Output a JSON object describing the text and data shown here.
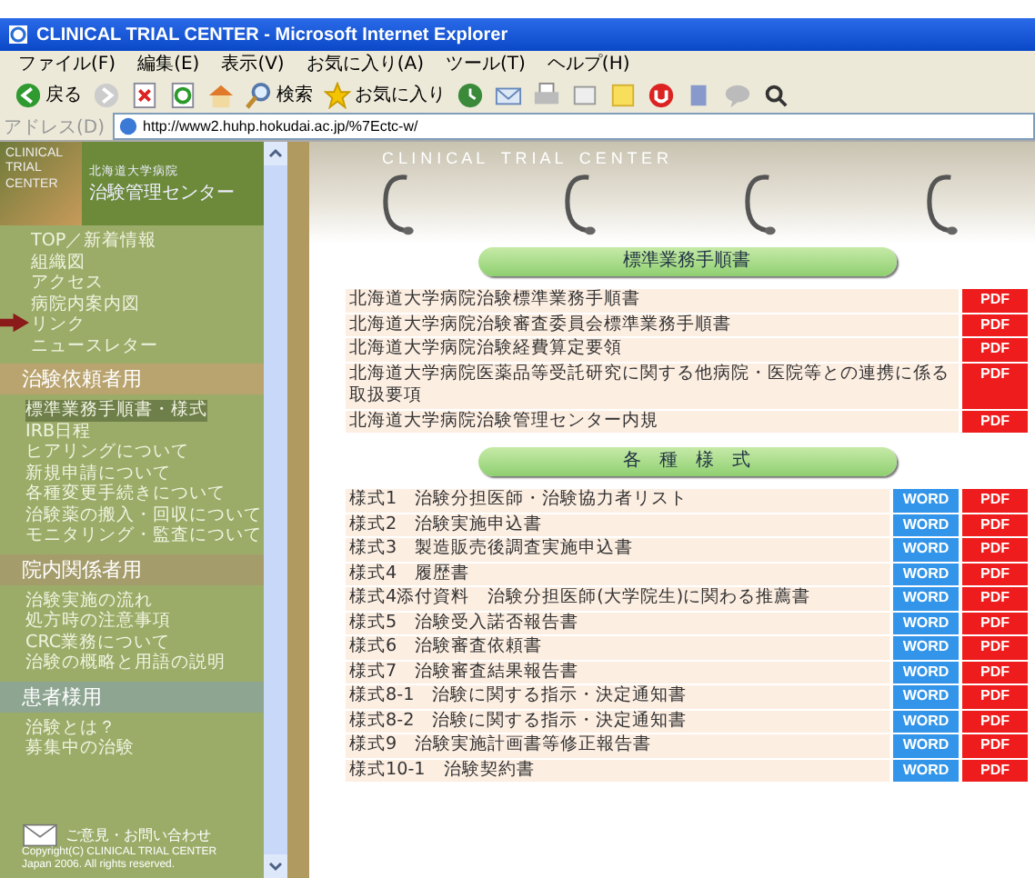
{
  "window": {
    "title": "CLINICAL TRIAL CENTER - Microsoft Internet Explorer"
  },
  "menu": [
    "ファイル(F)",
    "編集(E)",
    "表示(V)",
    "お気に入り(A)",
    "ツール(T)",
    "ヘルプ(H)"
  ],
  "toolbar": {
    "back": "戻る",
    "search": "検索",
    "favorites": "お気に入り"
  },
  "address": {
    "label": "アドレス(D)",
    "value": "http://www2.huhp.hokudai.ac.jp/%7Ectc-w/"
  },
  "sidebar": {
    "logo": {
      "image_text": "CLINICAL TRIAL CENTER",
      "org": "北海道大学病院",
      "name": "治験管理センター"
    },
    "links": [
      "TOP／新着情報",
      "組織図",
      "アクセス",
      "病院内案内図",
      "リンク",
      "ニュースレター"
    ],
    "sections": [
      {
        "title": "治験依頼者用",
        "color": "#b9a36e",
        "items": [
          {
            "label": "標準業務手順書・様式",
            "selected": true
          },
          {
            "label": "IRB日程",
            "selected": false
          },
          {
            "label": "ヒアリングについて",
            "selected": false
          },
          {
            "label": "新規申請について",
            "selected": false
          },
          {
            "label": "各種変更手続きについて",
            "selected": false
          },
          {
            "label": "治験薬の搬入・回収について",
            "selected": false
          },
          {
            "label": "モニタリング・監査について",
            "selected": false
          }
        ]
      },
      {
        "title": "院内関係者用",
        "color": "#a59c6b",
        "items": [
          {
            "label": "治験実施の流れ",
            "selected": false
          },
          {
            "label": "処方時の注意事項",
            "selected": false
          },
          {
            "label": "CRC業務について",
            "selected": false
          },
          {
            "label": "治験の概略と用語の説明",
            "selected": false
          }
        ]
      },
      {
        "title": "患者様用",
        "color": "#8ea592",
        "items": [
          {
            "label": "治験とは？",
            "selected": false
          },
          {
            "label": "募集中の治験",
            "selected": false
          }
        ]
      }
    ],
    "contact": "ご意見・お問い合わせ",
    "copyright": [
      "Copyright(C) CLINICAL TRIAL CENTER",
      "Japan 2006. All rights reserved."
    ]
  },
  "content": {
    "banner": "C L I N I C A L　T R I A L　C E N T E R",
    "sections": [
      {
        "title": "標準業務手順書",
        "rows": [
          {
            "label": "北海道大学病院治験標準業務手順書",
            "files": [
              "PDF"
            ]
          },
          {
            "label": "北海道大学病院治験審査委員会標準業務手順書",
            "files": [
              "PDF"
            ]
          },
          {
            "label": "北海道大学病院治験経費算定要領",
            "files": [
              "PDF"
            ]
          },
          {
            "label": "北海道大学病院医薬品等受託研究に関する他病院・医院等との連携に係る取扱要項",
            "files": [
              "PDF"
            ]
          },
          {
            "label": "北海道大学病院治験管理センター内規",
            "files": [
              "PDF"
            ]
          }
        ]
      },
      {
        "title": "各　種　様　式",
        "rows": [
          {
            "label": "様式1　治験分担医師・治験協力者リスト",
            "files": [
              "WORD",
              "PDF"
            ]
          },
          {
            "label": "様式2　治験実施申込書",
            "files": [
              "WORD",
              "PDF"
            ]
          },
          {
            "label": "様式3　製造販売後調査実施申込書",
            "files": [
              "WORD",
              "PDF"
            ]
          },
          {
            "label": "様式4　履歴書",
            "files": [
              "WORD",
              "PDF"
            ]
          },
          {
            "label": "様式4添付資料　治験分担医師(大学院生)に関わる推薦書",
            "files": [
              "WORD",
              "PDF"
            ]
          },
          {
            "label": "様式5　治験受入諾否報告書",
            "files": [
              "WORD",
              "PDF"
            ]
          },
          {
            "label": "様式6　治験審査依頼書",
            "files": [
              "WORD",
              "PDF"
            ]
          },
          {
            "label": "様式7　治験審査結果報告書",
            "files": [
              "WORD",
              "PDF"
            ]
          },
          {
            "label": "様式8-1　治験に関する指示・決定通知書",
            "files": [
              "WORD",
              "PDF"
            ]
          },
          {
            "label": "様式8-2　治験に関する指示・決定通知書",
            "files": [
              "WORD",
              "PDF"
            ]
          },
          {
            "label": "様式9　治験実施計画書等修正報告書",
            "files": [
              "WORD",
              "PDF"
            ]
          },
          {
            "label": "様式10-1　治験契約書",
            "files": [
              "WORD",
              "PDF"
            ]
          }
        ]
      }
    ]
  }
}
